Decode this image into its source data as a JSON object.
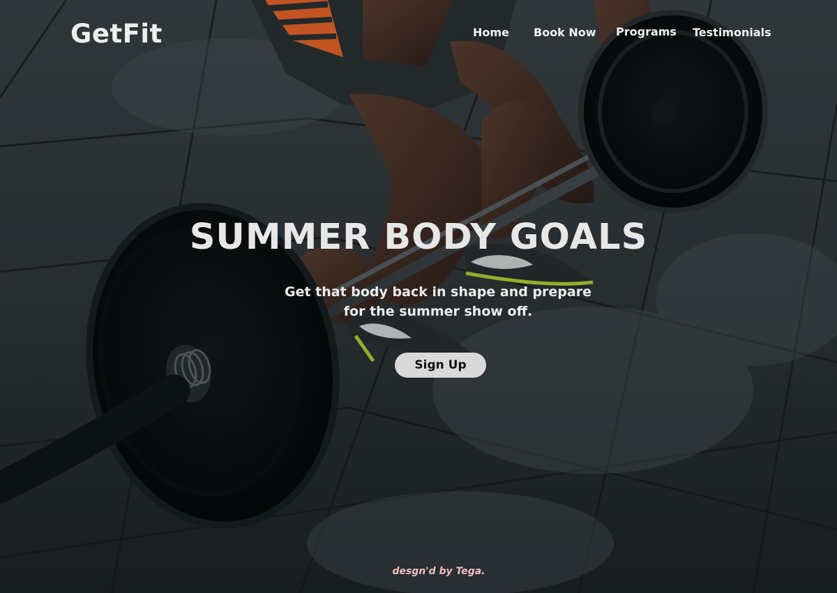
{
  "brand": {
    "name": "GetFit"
  },
  "nav": {
    "items": [
      {
        "label": "Home"
      },
      {
        "label": "Book Now"
      },
      {
        "label": "Programs"
      },
      {
        "label": "Testimonials"
      }
    ]
  },
  "hero": {
    "title": "SUMMER BODY GOALS",
    "subtitle": "Get that body back in shape and prepare for the summer show off.",
    "cta_label": "Sign Up"
  },
  "footer": {
    "credit": "desgn'd by Tega."
  },
  "colors": {
    "title": "#e7e7e7",
    "button_bg": "#d9d9d9",
    "footer_text": "#f1bfc0"
  }
}
